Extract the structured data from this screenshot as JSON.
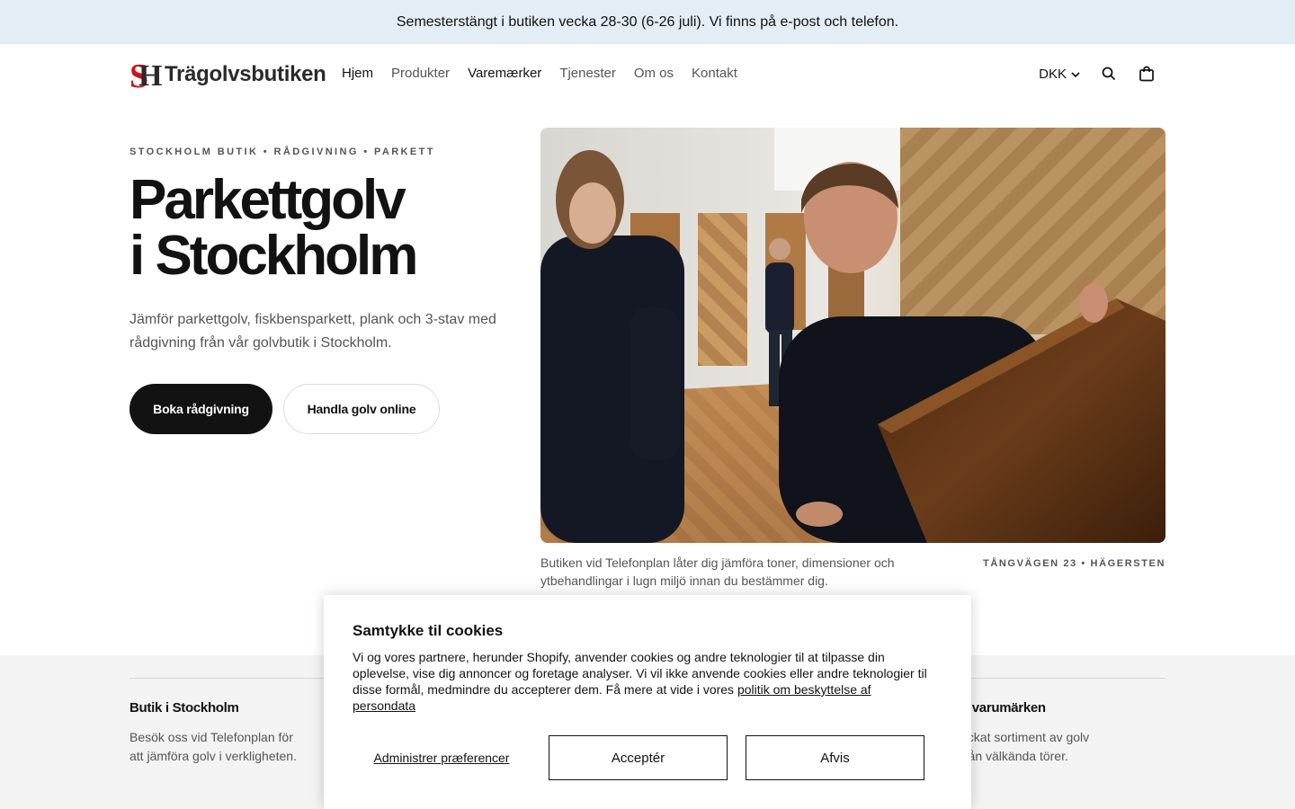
{
  "announcement": "Semesterstängt i butiken vecka 28-30 (6-26 juli). Vi finns på e-post och telefon.",
  "header": {
    "logo_text": "Trägolvsbutiken",
    "nav": [
      "Hjem",
      "Produkter",
      "Varemærker",
      "Tjenester",
      "Om os",
      "Kontakt"
    ],
    "currency": "DKK"
  },
  "hero": {
    "eyebrow": "STOCKHOLM BUTIK • RÅDGIVNING • PARKETT",
    "title_line1": "Parkettgolv",
    "title_line2": "i Stockholm",
    "text": "Jämför parkettgolv, fiskbensparkett, plank och 3-stav med rådgivning från vår golvbutik i Stockholm.",
    "primary_button": "Boka rådgivning",
    "secondary_button": "Handla golv online",
    "caption": "Butiken vid Telefonplan låter dig jämföra toner, dimensioner och ytbehandlingar i lugn miljö innan du bestämmer dig.",
    "address": "TÅNGVÄGEN 23 • HÄGERSTEN"
  },
  "info": {
    "col1_title": "Butik i Stockholm",
    "col1_text": "Besök oss vid Telefonplan för att jämföra golv i verkligheten.",
    "col4_title": "n varumärken",
    "col4_text": "ockat sortiment av golv från välkända törer."
  },
  "cookie": {
    "title": "Samtykke til cookies",
    "body": "Vi og vores partnere, herunder Shopify, anvender cookies og andre teknologier til at tilpasse din oplevelse, vise dig annoncer og foretage analyser. Vi vil ikke anvende cookies eller andre teknologier til disse formål, medmindre du accepterer dem. Få mere at vide i vores ",
    "policy_link": "politik om beskyttelse af persondata",
    "manage": "Administrer præferencer",
    "accept": "Acceptér",
    "reject": "Afvis"
  },
  "colors": {
    "announcement_bg": "#e3edf5",
    "primary": "#121212",
    "logo_red": "#c8161d"
  },
  "icons": [
    "chevron-down-icon",
    "search-icon",
    "cart-icon"
  ]
}
